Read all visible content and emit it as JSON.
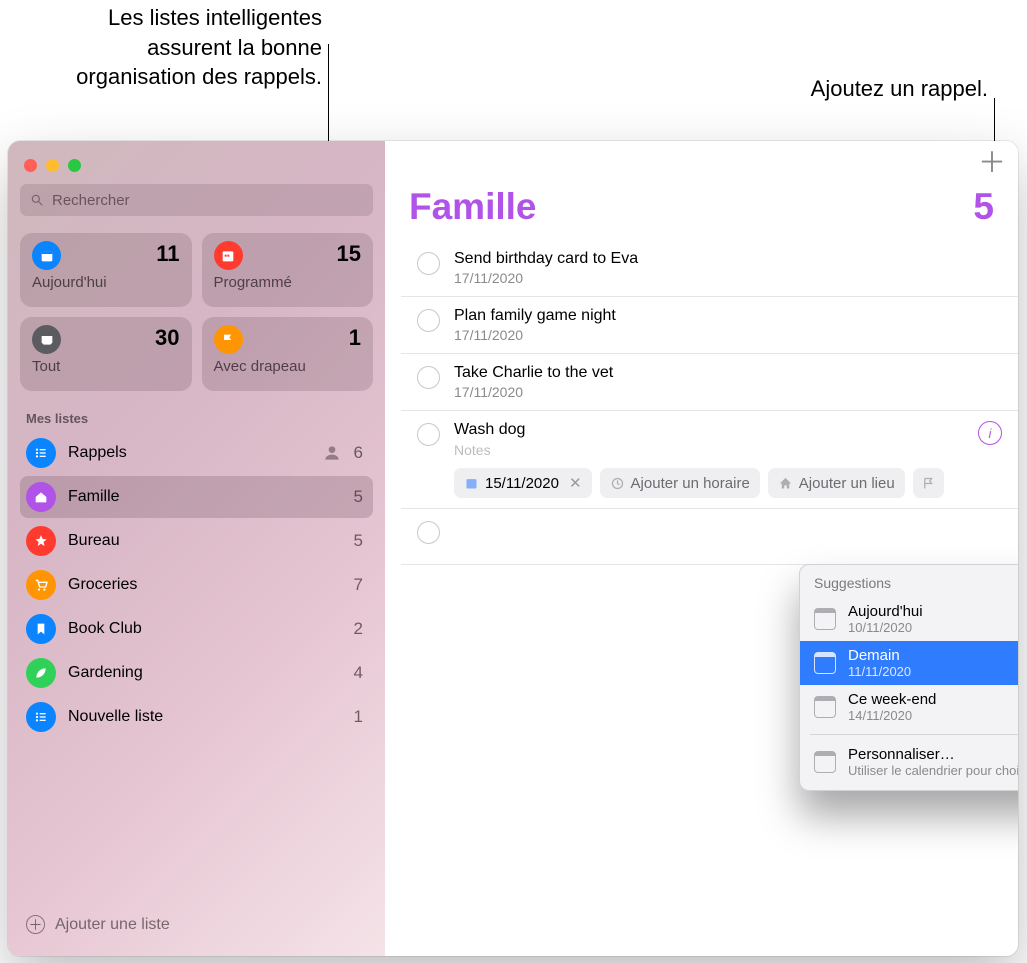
{
  "callouts": {
    "smartlists": "Les listes intelligentes assurent la bonne organisation des rappels.",
    "add_reminder": "Ajoutez un rappel."
  },
  "search": {
    "placeholder": "Rechercher"
  },
  "smart_lists": [
    {
      "label": "Aujourd'hui",
      "count": 11,
      "color": "#0a84ff"
    },
    {
      "label": "Programmé",
      "count": 15,
      "color": "#ff3b30"
    },
    {
      "label": "Tout",
      "count": 30,
      "color": "#5b5b60"
    },
    {
      "label": "Avec drapeau",
      "count": 1,
      "color": "#ff9502"
    }
  ],
  "mylists_title": "Mes listes",
  "lists": [
    {
      "name": "Rappels",
      "count": 6,
      "color": "#0a84ff",
      "shared": true
    },
    {
      "name": "Famille",
      "count": 5,
      "color": "#b152e8",
      "active": true
    },
    {
      "name": "Bureau",
      "count": 5,
      "color": "#ff3b30"
    },
    {
      "name": "Groceries",
      "count": 7,
      "color": "#ff9502"
    },
    {
      "name": "Book Club",
      "count": 2,
      "color": "#0a84ff"
    },
    {
      "name": "Gardening",
      "count": 4,
      "color": "#30d158"
    },
    {
      "name": "Nouvelle liste",
      "count": 1,
      "color": "#0a84ff"
    }
  ],
  "add_list_label": "Ajouter une liste",
  "main": {
    "title": "Famille",
    "count": 5
  },
  "reminders": [
    {
      "title": "Send birthday card to Eva",
      "date": "17/11/2020"
    },
    {
      "title": "Plan family game night",
      "date": "17/11/2020"
    },
    {
      "title": "Take Charlie to the vet",
      "date": "17/11/2020"
    }
  ],
  "editing": {
    "title": "Wash dog",
    "notes_placeholder": "Notes",
    "date": "15/11/2020",
    "add_time": "Ajouter un horaire",
    "add_location": "Ajouter un lieu"
  },
  "suggestions": {
    "title": "Suggestions",
    "items": [
      {
        "label": "Aujourd'hui",
        "sub": "10/11/2020"
      },
      {
        "label": "Demain",
        "sub": "11/11/2020",
        "selected": true
      },
      {
        "label": "Ce week-end",
        "sub": "14/11/2020"
      }
    ],
    "custom": {
      "label": "Personnaliser…",
      "sub": "Utiliser le calendrier pour choisir une date"
    }
  }
}
